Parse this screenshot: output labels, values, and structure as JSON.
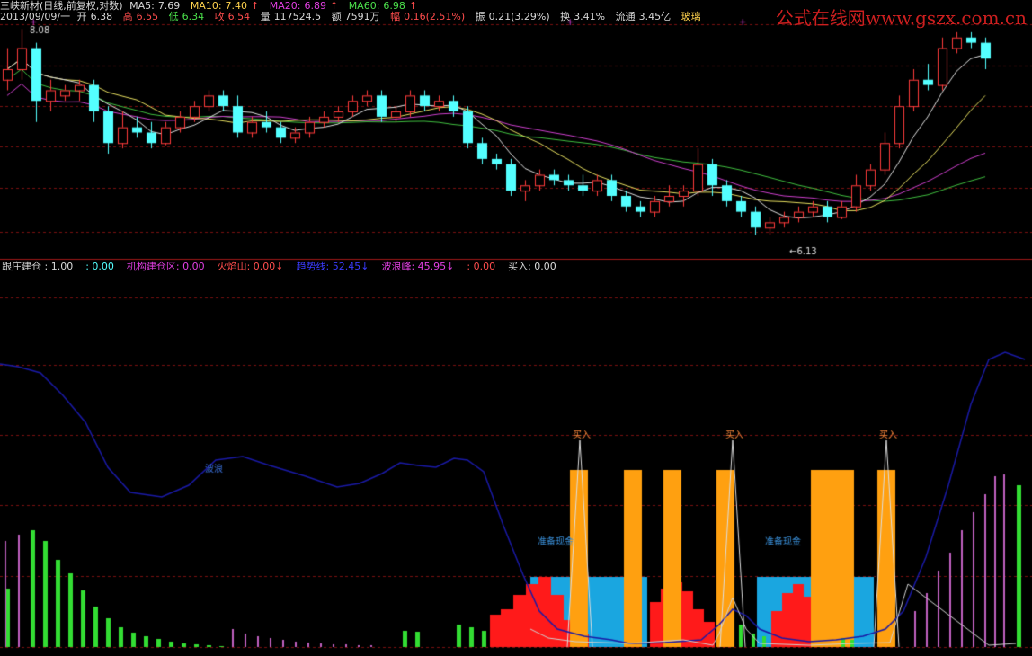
{
  "watermark": "公式在线网www.gszx.com.cn",
  "header": {
    "title": "三峡新材(日线,前复权,对数)",
    "ma5_label": "MA5:",
    "ma5": "7.69",
    "ma10_label": "MA10:",
    "ma10": "7.40",
    "ma20_label": "MA20:",
    "ma20": "6.89",
    "ma60_label": "MA60:",
    "ma60": "6.98",
    "arrow_up": "↑",
    "date": "2013/09/09/一",
    "open_label": "开",
    "open": "6.38",
    "high_label": "高",
    "high": "6.55",
    "low_label": "低",
    "low": "6.34",
    "close_label": "收",
    "close": "6.54",
    "vol_label": "量",
    "vol": "117524.5",
    "amt_label": "额",
    "amt": "7591万",
    "chg_label": "幅",
    "chg": "0.16(2.51%)",
    "amp_label": "振",
    "amp": "0.21(3.29%)",
    "turn_label": "换",
    "turn": "3.41%",
    "float_label": "流通",
    "float": "3.45亿",
    "sector": "玻璃"
  },
  "price_chart": {
    "high_marker": "8.08",
    "low_marker": "←6.13"
  },
  "indicator": {
    "items": [
      {
        "label": "跟庄建仓 : 1.00",
        "color": "#d8d8d8"
      },
      {
        "label": ": 0.00",
        "color": "#54ffff"
      },
      {
        "label": "机构建仓区: 0.00",
        "color": "#e23fe2"
      },
      {
        "label": "火焰山: 0.00",
        "color": "#ff4d4d",
        "arrow": "↓"
      },
      {
        "label": "趋势线: 52.45",
        "color": "#3b3bff",
        "arrow": "↓"
      },
      {
        "label": "波浪峰: 45.95",
        "color": "#e23fe2",
        "arrow": "↓"
      },
      {
        "label": ": 0.00",
        "color": "#ff4d4d"
      },
      {
        "label": "买入: 0.00",
        "color": "#d8d8d8"
      }
    ],
    "trend_label": "波浪",
    "prep_label_1": "准备现金",
    "prep_label_2": "准备现金",
    "buy_label": "买入"
  },
  "colors": {
    "candle_up": "#ff3b3b",
    "candle_down": "#54ffff",
    "ma5": "#e0e0e0",
    "ma10": "#e8e060",
    "ma20": "#d040d0",
    "ma60": "#40c040",
    "grid": "#7a1010",
    "bar_green": "#33dd33",
    "bar_magenta": "#c060c0",
    "bar_red": "#ff1a1a",
    "bar_cyan": "#1aa6e0",
    "bar_orange": "#ffa010",
    "trend_line": "#1a1aa6"
  },
  "chart_data": {
    "type": "candlestick",
    "candles_ohlc": [
      [
        7.6,
        7.9,
        7.5,
        7.7
      ],
      [
        7.7,
        8.08,
        7.6,
        7.9
      ],
      [
        7.9,
        7.95,
        7.2,
        7.4
      ],
      [
        7.4,
        7.6,
        7.3,
        7.5
      ],
      [
        7.45,
        7.55,
        7.4,
        7.5
      ],
      [
        7.5,
        7.6,
        7.4,
        7.55
      ],
      [
        7.55,
        7.6,
        7.2,
        7.3
      ],
      [
        7.3,
        7.35,
        6.9,
        7.0
      ],
      [
        7.0,
        7.3,
        6.95,
        7.15
      ],
      [
        7.15,
        7.25,
        7.05,
        7.1
      ],
      [
        7.1,
        7.2,
        6.95,
        7.0
      ],
      [
        7.0,
        7.2,
        6.98,
        7.15
      ],
      [
        7.15,
        7.3,
        7.1,
        7.25
      ],
      [
        7.25,
        7.4,
        7.2,
        7.35
      ],
      [
        7.35,
        7.5,
        7.3,
        7.45
      ],
      [
        7.45,
        7.5,
        7.3,
        7.35
      ],
      [
        7.35,
        7.45,
        7.05,
        7.1
      ],
      [
        7.1,
        7.25,
        7.05,
        7.2
      ],
      [
        7.2,
        7.3,
        7.1,
        7.15
      ],
      [
        7.15,
        7.2,
        7.0,
        7.05
      ],
      [
        7.05,
        7.15,
        7.0,
        7.1
      ],
      [
        7.1,
        7.25,
        7.05,
        7.2
      ],
      [
        7.2,
        7.3,
        7.15,
        7.25
      ],
      [
        7.25,
        7.35,
        7.2,
        7.3
      ],
      [
        7.3,
        7.45,
        7.25,
        7.4
      ],
      [
        7.4,
        7.5,
        7.35,
        7.45
      ],
      [
        7.45,
        7.5,
        7.2,
        7.25
      ],
      [
        7.25,
        7.35,
        7.2,
        7.3
      ],
      [
        7.3,
        7.5,
        7.25,
        7.45
      ],
      [
        7.45,
        7.5,
        7.3,
        7.35
      ],
      [
        7.35,
        7.45,
        7.3,
        7.4
      ],
      [
        7.4,
        7.45,
        7.25,
        7.3
      ],
      [
        7.3,
        7.35,
        6.95,
        7.0
      ],
      [
        7.0,
        7.05,
        6.8,
        6.85
      ],
      [
        6.85,
        6.9,
        6.75,
        6.8
      ],
      [
        6.8,
        6.85,
        6.5,
        6.55
      ],
      [
        6.55,
        6.65,
        6.45,
        6.6
      ],
      [
        6.6,
        6.75,
        6.55,
        6.7
      ],
      [
        6.7,
        6.75,
        6.6,
        6.65
      ],
      [
        6.65,
        6.7,
        6.55,
        6.6
      ],
      [
        6.6,
        6.7,
        6.5,
        6.55
      ],
      [
        6.55,
        6.7,
        6.5,
        6.65
      ],
      [
        6.65,
        6.7,
        6.45,
        6.5
      ],
      [
        6.5,
        6.55,
        6.35,
        6.4
      ],
      [
        6.4,
        6.45,
        6.3,
        6.35
      ],
      [
        6.35,
        6.5,
        6.3,
        6.45
      ],
      [
        6.45,
        6.6,
        6.4,
        6.5
      ],
      [
        6.5,
        6.6,
        6.4,
        6.55
      ],
      [
        6.55,
        6.95,
        6.5,
        6.8
      ],
      [
        6.8,
        6.85,
        6.5,
        6.6
      ],
      [
        6.6,
        6.65,
        6.4,
        6.45
      ],
      [
        6.45,
        6.5,
        6.3,
        6.35
      ],
      [
        6.35,
        6.4,
        6.13,
        6.2
      ],
      [
        6.2,
        6.3,
        6.13,
        6.25
      ],
      [
        6.25,
        6.35,
        6.2,
        6.3
      ],
      [
        6.3,
        6.4,
        6.25,
        6.35
      ],
      [
        6.35,
        6.45,
        6.3,
        6.4
      ],
      [
        6.4,
        6.45,
        6.25,
        6.3
      ],
      [
        6.3,
        6.45,
        6.28,
        6.4
      ],
      [
        6.4,
        6.7,
        6.35,
        6.6
      ],
      [
        6.6,
        6.8,
        6.55,
        6.75
      ],
      [
        6.75,
        7.1,
        6.7,
        7.0
      ],
      [
        7.0,
        7.45,
        6.95,
        7.35
      ],
      [
        7.35,
        7.7,
        7.3,
        7.6
      ],
      [
        7.6,
        7.75,
        7.5,
        7.55
      ],
      [
        7.55,
        8.0,
        7.5,
        7.9
      ],
      [
        7.9,
        8.05,
        7.85,
        8.0
      ],
      [
        8.0,
        8.05,
        7.9,
        7.95
      ],
      [
        7.95,
        8.0,
        7.7,
        7.8
      ]
    ]
  }
}
